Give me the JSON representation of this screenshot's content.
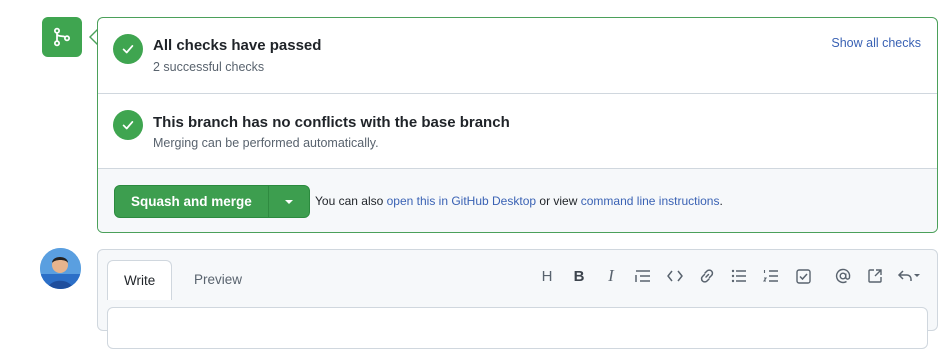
{
  "checks": {
    "title": "All checks have passed",
    "subtitle": "2 successful checks",
    "show_all_label": "Show all checks"
  },
  "conflicts": {
    "title": "This branch has no conflicts with the base branch",
    "subtitle": "Merging can be performed automatically."
  },
  "merge": {
    "button_label": "Squash and merge",
    "also_prefix": "You can also",
    "desktop_link": "open this in GitHub Desktop",
    "or_view": "or view",
    "cli_link": "command line instructions",
    "suffix": "."
  },
  "comment": {
    "tabs": [
      "Write",
      "Preview"
    ],
    "toolbar_icons": [
      "heading-icon",
      "bold-icon",
      "italic-icon",
      "quote-icon",
      "code-icon",
      "link-icon",
      "bullet-list-icon",
      "numbered-list-icon",
      "task-list-icon",
      "mention-icon",
      "reference-icon",
      "reply-icon"
    ],
    "toolbar_glyphs": {
      "heading": "H",
      "bold": "B",
      "italic": "I"
    }
  },
  "colors": {
    "success": "#3fa550",
    "link": "#3a62b4",
    "border_success": "#4ba05a"
  }
}
